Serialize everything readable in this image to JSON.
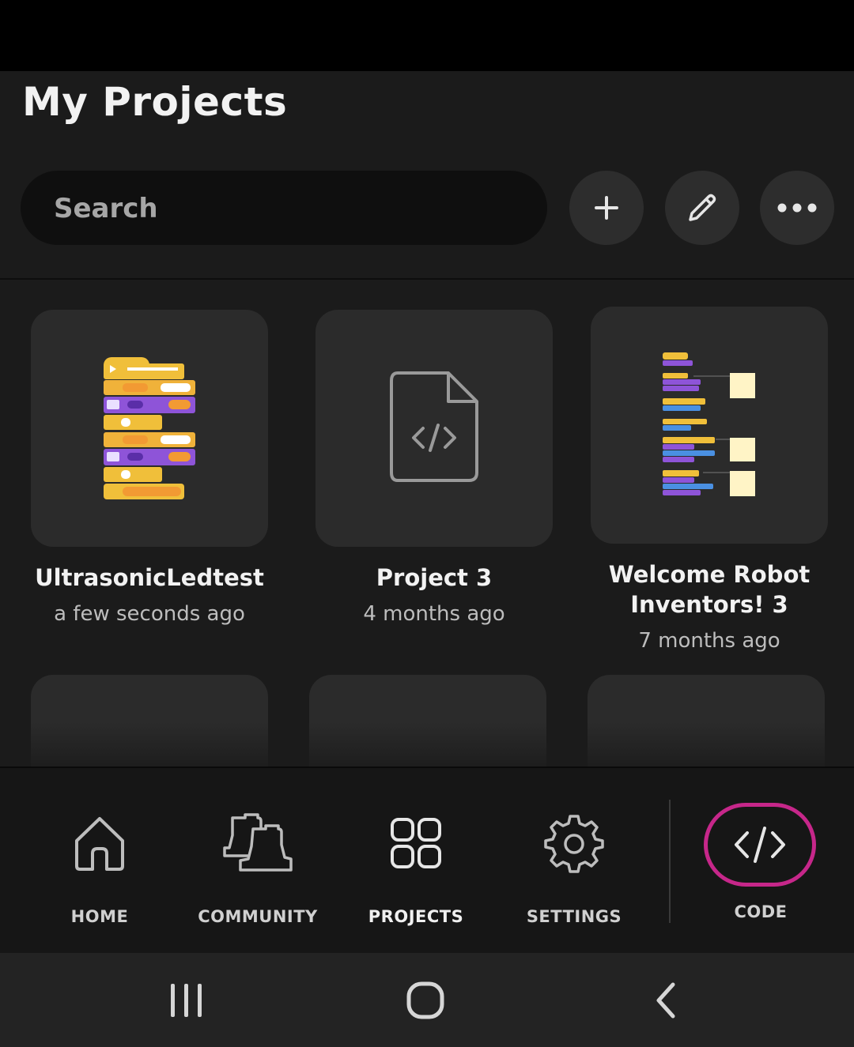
{
  "header": {
    "title": "My Projects",
    "search_placeholder": "Search"
  },
  "toolbar": {
    "add_icon": "plus-icon",
    "edit_icon": "pencil-icon",
    "more_icon": "more-horizontal-icon"
  },
  "projects": [
    {
      "title": "UltrasonicLedtest",
      "time": "a few seconds ago",
      "thumbnail": "block-code-preview"
    },
    {
      "title": "Project 3",
      "time": "4 months ago",
      "thumbnail": "code-file-icon"
    },
    {
      "title": "Welcome Robot Inventors! 3",
      "time": "7 months ago",
      "thumbnail": "block-code-preview"
    }
  ],
  "nav": {
    "home": "HOME",
    "community": "COMMUNITY",
    "projects": "PROJECTS",
    "settings": "SETTINGS",
    "code": "CODE"
  },
  "colors": {
    "accent": "#c6278a",
    "background": "#1b1b1b",
    "card": "#2b2b2b"
  }
}
